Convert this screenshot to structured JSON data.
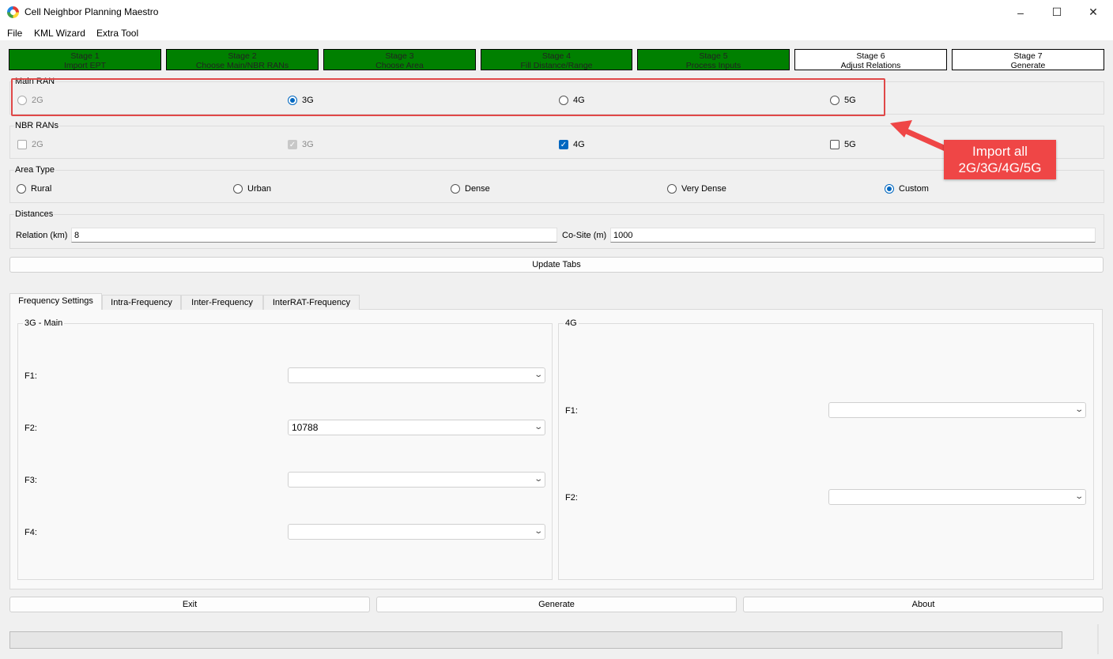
{
  "window": {
    "title": "Cell Neighbor Planning Maestro",
    "minimize": "–",
    "maximize": "☐",
    "close": "✕"
  },
  "menu": [
    "File",
    "KML Wizard",
    "Extra Tool"
  ],
  "stages": [
    {
      "line1": "Stage 1",
      "line2": "Import EPT",
      "status": "done"
    },
    {
      "line1": "Stage 2",
      "line2": "Choose Main/NBR RANs",
      "status": "done"
    },
    {
      "line1": "Stage 3",
      "line2": "Choose Area",
      "status": "current"
    },
    {
      "line1": "Stage 4",
      "line2": "Fill Distance/Range",
      "status": "done"
    },
    {
      "line1": "Stage 5",
      "line2": "Process Inputs",
      "status": "done"
    },
    {
      "line1": "Stage 6",
      "line2": "Adjust Relations",
      "status": "todo"
    },
    {
      "line1": "Stage 7",
      "line2": "Generate",
      "status": "todo"
    }
  ],
  "main_ran": {
    "title": "Main RAN",
    "options": [
      {
        "label": "2G",
        "checked": false,
        "disabled": true
      },
      {
        "label": "3G",
        "checked": true,
        "disabled": false
      },
      {
        "label": "4G",
        "checked": false,
        "disabled": false
      },
      {
        "label": "5G",
        "checked": false,
        "disabled": false
      }
    ]
  },
  "nbr_rans": {
    "title": "NBR RANs",
    "options": [
      {
        "label": "2G",
        "checked": false,
        "disabled": true
      },
      {
        "label": "3G",
        "checked": true,
        "disabled": true
      },
      {
        "label": "4G",
        "checked": true,
        "disabled": false
      },
      {
        "label": "5G",
        "checked": false,
        "disabled": false
      }
    ]
  },
  "area_type": {
    "title": "Area Type",
    "options": [
      {
        "label": "Rural",
        "checked": false
      },
      {
        "label": "Urban",
        "checked": false
      },
      {
        "label": "Dense",
        "checked": false
      },
      {
        "label": "Very Dense",
        "checked": false
      },
      {
        "label": "Custom",
        "checked": true
      }
    ]
  },
  "distances": {
    "title": "Distances",
    "relation_label": "Relation (km)",
    "relation_value": "8",
    "cosite_label": "Co-Site (m)",
    "cosite_value": "1000"
  },
  "update_tabs_label": "Update Tabs",
  "tabs": [
    {
      "label": "Frequency Settings",
      "active": true
    },
    {
      "label": "Intra-Frequency",
      "active": false
    },
    {
      "label": "Inter-Frequency",
      "active": false
    },
    {
      "label": "InterRAT-Frequency",
      "active": false
    }
  ],
  "freq_main": {
    "title": "3G - Main",
    "rows": [
      {
        "label": "F1:",
        "value": ""
      },
      {
        "label": "F2:",
        "value": "10788"
      },
      {
        "label": "F3:",
        "value": ""
      },
      {
        "label": "F4:",
        "value": ""
      }
    ]
  },
  "freq_nbr": {
    "title": "4G",
    "rows": [
      {
        "label": "F1:",
        "value": ""
      },
      {
        "label": "F2:",
        "value": ""
      }
    ]
  },
  "buttons": {
    "exit": "Exit",
    "generate": "Generate",
    "about": "About"
  },
  "progress_value": 0,
  "annotation": {
    "line1": "Import all",
    "line2": "2G/3G/4G/5G",
    "color": "#ef4646"
  },
  "colors": {
    "stage_done": "#008000",
    "accent": "#0067c0"
  }
}
